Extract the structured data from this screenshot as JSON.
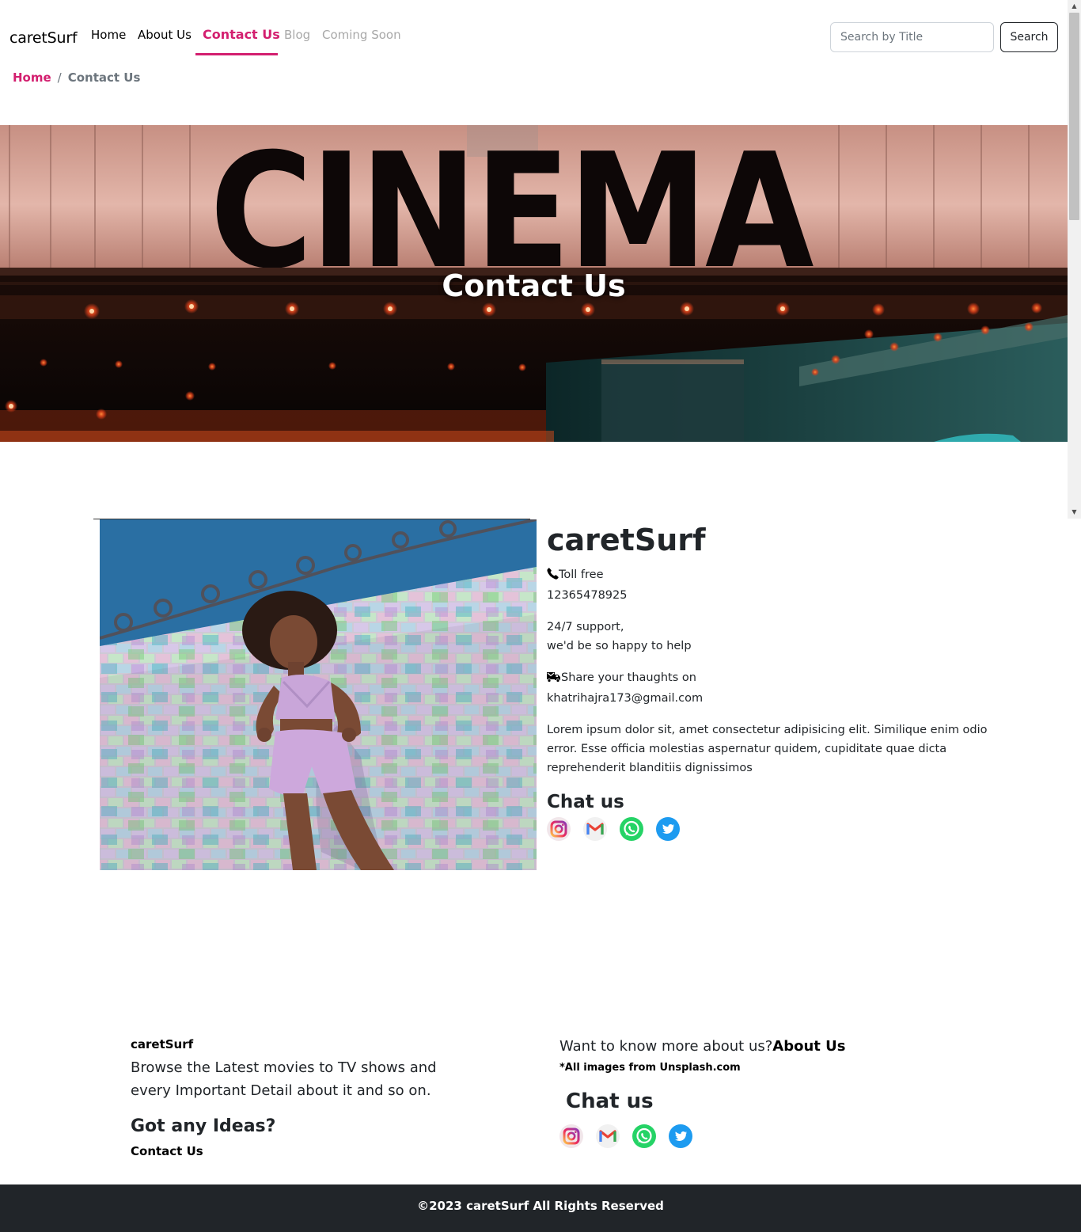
{
  "navbar": {
    "brand": "caretSurf",
    "links": [
      {
        "label": "Home",
        "state": "normal"
      },
      {
        "label": "About Us",
        "state": "normal"
      },
      {
        "label": "Contact Us",
        "state": "active"
      },
      {
        "label": "Blog",
        "state": "disabled"
      },
      {
        "label": "Coming Soon",
        "state": "disabled"
      }
    ],
    "search_placeholder": "Search by Title",
    "search_value": "",
    "search_button": "Search"
  },
  "breadcrumb": {
    "home": "Home",
    "separator": "/",
    "current": "Contact Us"
  },
  "hero": {
    "sign_text": "CINEMA",
    "title": "Contact Us"
  },
  "contact": {
    "company": "caretSurf",
    "phone_label": "Toll free",
    "phone_number": "12365478925",
    "support_line1": "24/7 support,",
    "support_line2": "we'd be so happy to help",
    "email_label": "Share your thaughts on",
    "email": "khatrihajra173@gmail.com",
    "lorem": "Lorem ipsum dolor sit, amet consectetur adipisicing elit. Similique enim odio error. Esse officia molestias aspernatur quidem, cupiditate quae dicta reprehenderit blanditiis dignissimos",
    "chat_title": "Chat us",
    "social_icons": [
      "instagram-icon",
      "gmail-icon",
      "whatsapp-icon",
      "twitter-icon"
    ]
  },
  "footer": {
    "brand": "caretSurf",
    "description": "Browse the Latest movies to TV shows and every Important Detail about it and so on.",
    "ideas_title": "Got any Ideas?",
    "contact_link": "Contact Us",
    "more_text": "Want to know more about us?",
    "more_link": "About Us",
    "images_credit": "*All images from Unsplash.com",
    "chat_title": "Chat us",
    "copyright": "©2023 caretSurf All Rights Reserved"
  },
  "colors": {
    "accent": "#d31f6f",
    "muted": "#6c757d",
    "disabled": "#a8a8a8",
    "footer_bg": "#212529"
  }
}
